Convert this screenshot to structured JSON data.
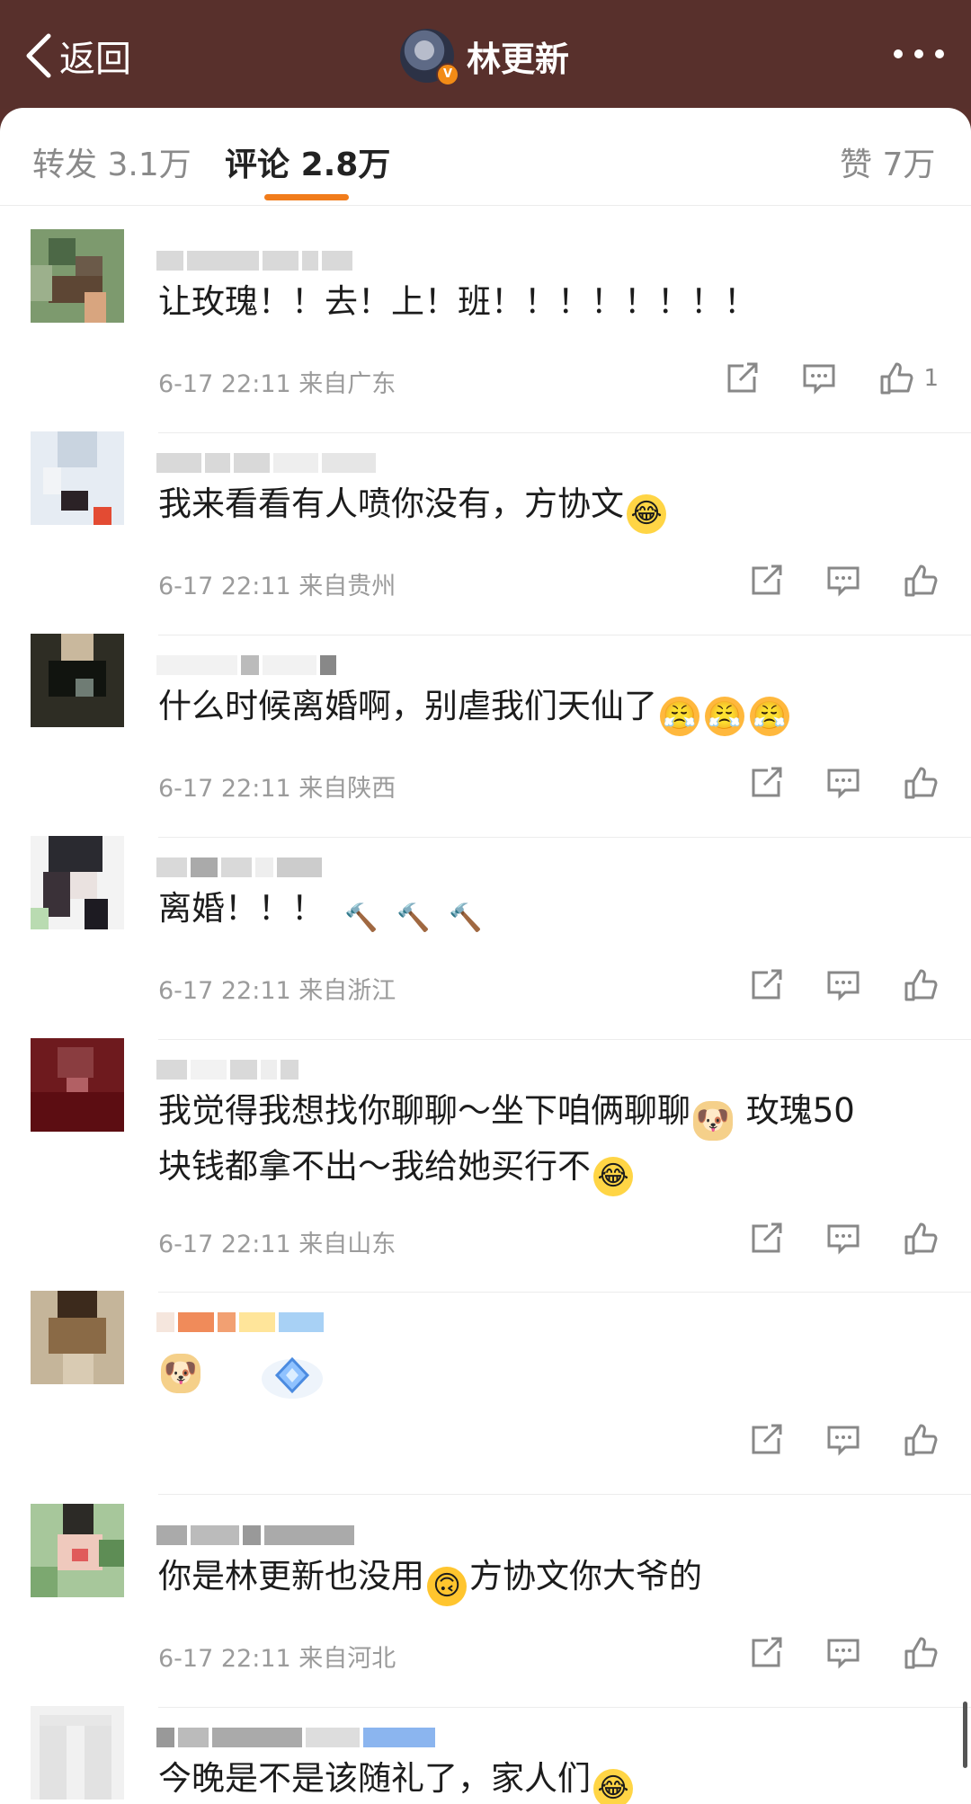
{
  "header": {
    "back_label": "返回",
    "title": "林更新",
    "verified_badge": "V",
    "more_icon": "more-dots-icon"
  },
  "tabs": {
    "repost_label": "转发",
    "repost_count": "3.1万",
    "comment_label": "评论",
    "comment_count": "2.8万",
    "like_label": "赞",
    "like_count": "7万"
  },
  "colors": {
    "header_bg": "#58302c",
    "accent": "#f17c1b"
  },
  "comments": [
    {
      "text": "让玫瑰！！去！上！班！！！！！！！！",
      "time": "6-17 22:11",
      "from": "来自广东",
      "likes": "1"
    },
    {
      "text": "我来看看有人喷你没有，方协文",
      "emojis": [
        "😂"
      ],
      "time": "6-17 22:11",
      "from": "来自贵州",
      "likes": ""
    },
    {
      "text": "什么时候离婚啊，别虐我们天仙了",
      "emojis": [
        "😤",
        "😤",
        "😤"
      ],
      "time": "6-17 22:11",
      "from": "来自陕西",
      "likes": ""
    },
    {
      "text": "离婚！！！",
      "emojis": [
        "🔨",
        "🔨",
        "🔨"
      ],
      "time": "6-17 22:11",
      "from": "来自浙江",
      "likes": ""
    },
    {
      "text_line1": "我觉得我想找你聊聊～坐下咱俩聊聊",
      "text_line1_b": "玫瑰50",
      "text_line2": "块钱都拿不出～我给她买行不",
      "time": "6-17 22:11",
      "from": "来自山东",
      "likes": ""
    },
    {
      "text": "",
      "time": "",
      "from": "",
      "likes": ""
    },
    {
      "text": "你是林更新也没用",
      "text_b": "方协文你大爷的",
      "time": "6-17 22:11",
      "from": "来自河北",
      "likes": ""
    },
    {
      "text": "今晚是不是该随礼了，家人们",
      "time": "",
      "from": "",
      "likes": ""
    }
  ]
}
